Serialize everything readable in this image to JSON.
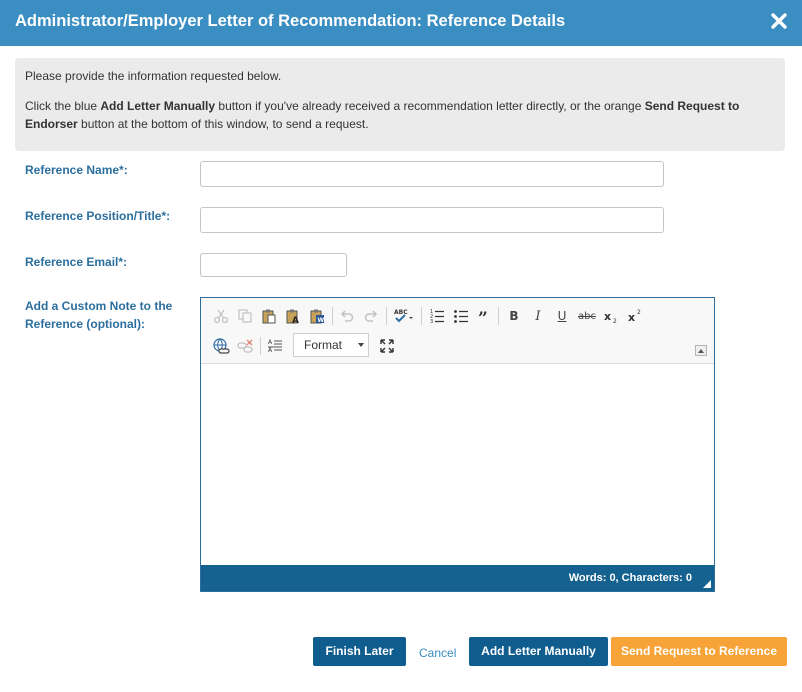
{
  "dialog": {
    "title": "Administrator/Employer Letter of Recommendation: Reference Details",
    "close_icon": "close-icon"
  },
  "info": {
    "line1": "Please provide the information requested below.",
    "line2_a": "Click the blue ",
    "line2_b": "Add Letter Manually",
    "line2_c": " button if you've already received a recommendation letter directly, or the orange ",
    "line2_d": "Send Request to Endorser",
    "line2_e": " button at the bottom of this window, to send a request."
  },
  "form": {
    "reference_name_label": "Reference Name*:",
    "reference_name_value": "",
    "reference_position_label": "Reference Position/Title*:",
    "reference_position_value": "",
    "reference_email_label": "Reference Email*:",
    "reference_email_value": "",
    "custom_note_label_line1": "Add a Custom Note to the",
    "custom_note_label_line2": "Reference (optional):"
  },
  "editor": {
    "toolbar_icons": [
      "cut-icon",
      "copy-icon",
      "paste-icon",
      "paste-text-icon",
      "paste-word-icon",
      "undo-icon",
      "redo-icon",
      "spellcheck-icon",
      "numbered-list-icon",
      "bulleted-list-icon",
      "blockquote-icon",
      "bold-icon",
      "italic-icon",
      "underline-icon",
      "strikethrough-icon",
      "subscript-icon",
      "superscript-icon",
      "link-icon",
      "unlink-icon",
      "text-direction-icon",
      "maximize-icon"
    ],
    "format_label": "Format",
    "word_count": "Words: 0, Characters: 0"
  },
  "buttons": {
    "finish_later": "Finish Later",
    "cancel": "Cancel",
    "add_letter": "Add Letter Manually",
    "send_request": "Send Request to Reference"
  },
  "colors": {
    "header": "#3a8ec2",
    "label": "#2c6f9e",
    "primary_button": "#0f5c8f",
    "orange_button": "#f7a337",
    "editor_footer": "#15618f"
  }
}
